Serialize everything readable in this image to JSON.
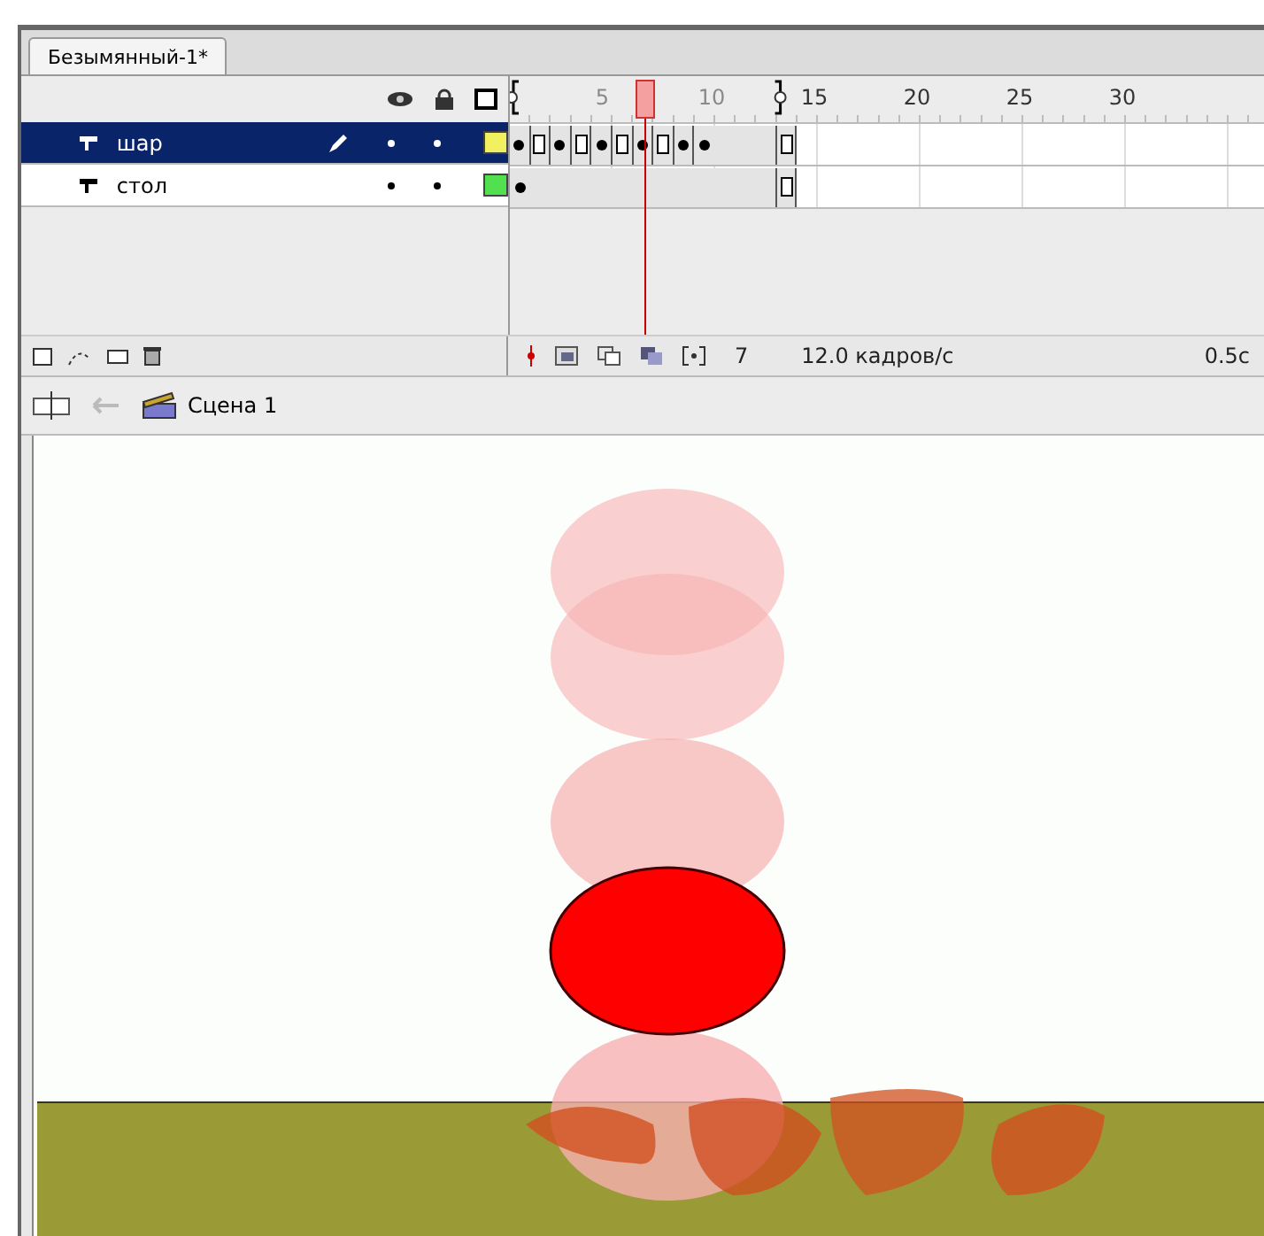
{
  "document_tab": {
    "label": "Безымянный-1*",
    "selected": true
  },
  "onion_skin": true,
  "ruler_labels": [
    {
      "label": "5",
      "dimmed": true
    },
    {
      "label": "10",
      "dimmed": true
    },
    {
      "label": "15",
      "dimmed": false
    },
    {
      "label": "20",
      "dimmed": false
    },
    {
      "label": "25",
      "dimmed": false
    },
    {
      "label": "30",
      "dimmed": false
    }
  ],
  "layers": [
    {
      "name": "шар",
      "selected": true,
      "editing": true,
      "color": "#f0f060",
      "frames": [
        {
          "kind": "key"
        },
        {
          "kind": "end"
        },
        {
          "kind": "key"
        },
        {
          "kind": "end"
        },
        {
          "kind": "key"
        },
        {
          "kind": "end"
        },
        {
          "kind": "key"
        },
        {
          "kind": "end"
        },
        {
          "kind": "key"
        },
        {
          "kind": "key"
        },
        {
          "kind": "span"
        },
        {
          "kind": "span"
        },
        {
          "kind": "span"
        },
        {
          "kind": "end"
        }
      ]
    },
    {
      "name": "стол",
      "selected": false,
      "editing": false,
      "color": "#50e050",
      "frames": [
        {
          "kind": "key"
        },
        {
          "kind": "span"
        },
        {
          "kind": "span"
        },
        {
          "kind": "span"
        },
        {
          "kind": "span"
        },
        {
          "kind": "span"
        },
        {
          "kind": "span"
        },
        {
          "kind": "span"
        },
        {
          "kind": "span"
        },
        {
          "kind": "span"
        },
        {
          "kind": "span"
        },
        {
          "kind": "span"
        },
        {
          "kind": "span"
        },
        {
          "kind": "end"
        }
      ]
    }
  ],
  "status": {
    "frame": "7",
    "rate": "12.0 кадров/с",
    "time": "0.5с"
  },
  "scene": {
    "label": "Сцена 1"
  }
}
